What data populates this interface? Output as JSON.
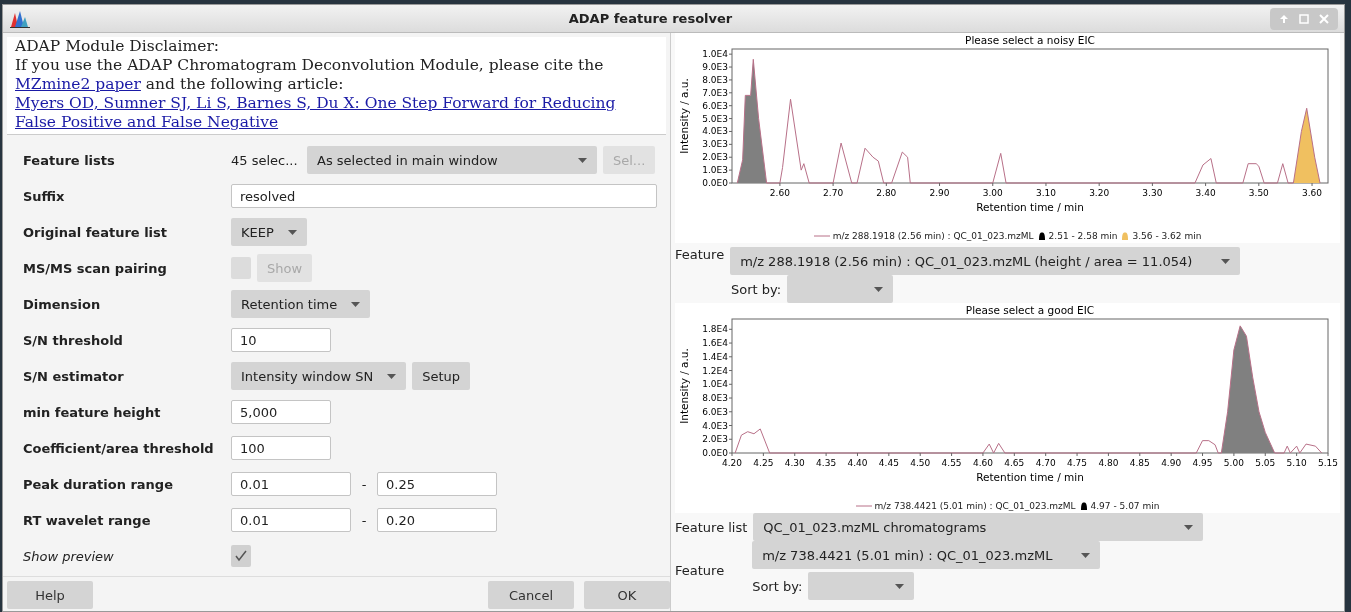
{
  "window": {
    "title": "ADAP feature resolver"
  },
  "disclaimer": {
    "heading": "ADAP Module Disclaimer:",
    "text_before": "If you use the ADAP Chromatogram Deconvolution Module, please cite the",
    "link_paper": "MZmine2 paper",
    "text_after": "and the following article:",
    "link_article": "Myers OD, Sumner SJ, Li S, Barnes S, Du X: One Step Forward for Reducing False Positive and False Negative"
  },
  "parameters": [
    {
      "label": "Feature lists",
      "kind": "selector",
      "count": "45 selec...",
      "value": "As selected in main window",
      "button": "Sel...",
      "disabled": true
    },
    {
      "label": "Suffix",
      "kind": "text",
      "value": "resolved"
    },
    {
      "label": "Original feature list",
      "kind": "combo",
      "value": "KEEP"
    },
    {
      "label": "MS/MS scan pairing",
      "kind": "checkbutton",
      "checked": false,
      "button": "Show",
      "disabled": true
    },
    {
      "label": "Dimension",
      "kind": "combo",
      "value": "Retention time"
    },
    {
      "label": "S/N threshold",
      "kind": "number",
      "value": "10"
    },
    {
      "label": "S/N estimator",
      "kind": "combo",
      "value": "Intensity window SN",
      "button": "Setup"
    },
    {
      "label": "min feature height",
      "kind": "number",
      "value": "5,000"
    },
    {
      "label": "Coefficient/area threshold",
      "kind": "number",
      "value": "100"
    },
    {
      "label": "Peak duration range",
      "kind": "range",
      "from": "0.01",
      "separator": "-",
      "to": "0.25"
    },
    {
      "label": "RT wavelet range",
      "kind": "range",
      "from": "0.01",
      "separator": "-",
      "to": "0.20"
    },
    {
      "label": "Show preview",
      "kind": "checkbox",
      "checked": true
    }
  ],
  "buttons": {
    "help": "Help",
    "cancel": "Cancel",
    "ok": "OK"
  },
  "noisy_preview": {
    "chart_data": {
      "type": "line",
      "title": "Please select a noisy EIC",
      "xlabel": "Retention time / min",
      "ylabel": "Intensity / a.u.",
      "xlim": [
        2.51,
        3.63
      ],
      "ylim": [
        0,
        10400
      ],
      "xticks": [
        {
          "value": 2.6,
          "label": "2.60"
        },
        {
          "value": 2.7,
          "label": "2.70"
        },
        {
          "value": 2.8,
          "label": "2.80"
        },
        {
          "value": 2.9,
          "label": "2.90"
        },
        {
          "value": 3.0,
          "label": "3.00"
        },
        {
          "value": 3.1,
          "label": "3.10"
        },
        {
          "value": 3.2,
          "label": "3.20"
        },
        {
          "value": 3.3,
          "label": "3.30"
        },
        {
          "value": 3.4,
          "label": "3.40"
        },
        {
          "value": 3.5,
          "label": "3.50"
        },
        {
          "value": 3.6,
          "label": "3.60"
        }
      ],
      "yticks": [
        {
          "value": 0,
          "label": "0.0E0"
        },
        {
          "value": 1000,
          "label": "1.0E3"
        },
        {
          "value": 2000,
          "label": "2.0E3"
        },
        {
          "value": 3000,
          "label": "3.0E3"
        },
        {
          "value": 4000,
          "label": "4.0E3"
        },
        {
          "value": 5000,
          "label": "5.0E3"
        },
        {
          "value": 6000,
          "label": "6.0E3"
        },
        {
          "value": 7000,
          "label": "7.0E3"
        },
        {
          "value": 8000,
          "label": "8.0E3"
        },
        {
          "value": 9000,
          "label": "9.0E3"
        },
        {
          "value": 10000,
          "label": "1.0E4"
        }
      ],
      "x": [
        2.52,
        2.53,
        2.535,
        2.545,
        2.55,
        2.56,
        2.575,
        2.6,
        2.605,
        2.62,
        2.64,
        2.645,
        2.655,
        2.7,
        2.715,
        2.735,
        2.745,
        2.76,
        2.775,
        2.785,
        2.795,
        2.81,
        2.83,
        2.84,
        2.845,
        3.0,
        3.015,
        3.025,
        3.38,
        3.395,
        3.41,
        3.42,
        3.47,
        3.48,
        3.495,
        3.5,
        3.51,
        3.535,
        3.545,
        3.555,
        3.565,
        3.58,
        3.59,
        3.605,
        3.615
      ],
      "series": [
        {
          "name": "m/z 288.1918 (2.56 min) : QC_01_023.mzML",
          "type": "line",
          "color": "#b87088",
          "values": [
            0,
            1800,
            6800,
            6800,
            9600,
            5000,
            0,
            0,
            1200,
            6500,
            1000,
            1500,
            0,
            0,
            3100,
            0,
            0,
            2700,
            2000,
            1700,
            0,
            0,
            2400,
            2000,
            0,
            0,
            2300,
            0,
            0,
            1400,
            1900,
            0,
            0,
            1500,
            1500,
            1300,
            0,
            0,
            1500,
            0,
            0,
            4000,
            5800,
            2000,
            0
          ]
        },
        {
          "name": "2.51 - 2.58 min",
          "type": "area",
          "color": "#808080",
          "values": [
            0,
            1800,
            6800,
            6800,
            9600,
            5000,
            0,
            null,
            null,
            null,
            null,
            null,
            null,
            null,
            null,
            null,
            null,
            null,
            null,
            null,
            null,
            null,
            null,
            null,
            null,
            null,
            null,
            null,
            null,
            null,
            null,
            null,
            null,
            null,
            null,
            null,
            null,
            null,
            null,
            null,
            null,
            null,
            null,
            null,
            null
          ]
        },
        {
          "name": "3.56 - 3.62 min",
          "type": "area",
          "color": "#f0c060",
          "values": [
            null,
            null,
            null,
            null,
            null,
            null,
            null,
            null,
            null,
            null,
            null,
            null,
            null,
            null,
            null,
            null,
            null,
            null,
            null,
            null,
            null,
            null,
            null,
            null,
            null,
            null,
            null,
            null,
            null,
            null,
            null,
            null,
            null,
            null,
            null,
            null,
            null,
            null,
            null,
            null,
            0,
            4000,
            5800,
            2000,
            0
          ]
        }
      ]
    },
    "feature_label": "Feature",
    "feature_value": "m/z 288.1918 (2.56 min) : QC_01_023.mzML (height / area = 11.054)",
    "sort_label": "Sort by:"
  },
  "good_preview": {
    "chart_data": {
      "type": "line",
      "title": "Please select a good EIC",
      "xlabel": "Retention time / min",
      "ylabel": "Intensity / a.u.",
      "xlim": [
        4.2,
        5.15
      ],
      "ylim": [
        0,
        19500
      ],
      "xticks": [
        {
          "value": 4.2,
          "label": "4.20"
        },
        {
          "value": 4.25,
          "label": "4.25"
        },
        {
          "value": 4.3,
          "label": "4.30"
        },
        {
          "value": 4.35,
          "label": "4.35"
        },
        {
          "value": 4.4,
          "label": "4.40"
        },
        {
          "value": 4.45,
          "label": "4.45"
        },
        {
          "value": 4.5,
          "label": "4.50"
        },
        {
          "value": 4.55,
          "label": "4.55"
        },
        {
          "value": 4.6,
          "label": "4.60"
        },
        {
          "value": 4.65,
          "label": "4.65"
        },
        {
          "value": 4.7,
          "label": "4.70"
        },
        {
          "value": 4.75,
          "label": "4.75"
        },
        {
          "value": 4.8,
          "label": "4.80"
        },
        {
          "value": 4.85,
          "label": "4.85"
        },
        {
          "value": 4.9,
          "label": "4.90"
        },
        {
          "value": 4.95,
          "label": "4.95"
        },
        {
          "value": 5.0,
          "label": "5.00"
        },
        {
          "value": 5.05,
          "label": "5.05"
        },
        {
          "value": 5.1,
          "label": "5.10"
        },
        {
          "value": 5.15,
          "label": "5.15"
        }
      ],
      "yticks": [
        {
          "value": 0,
          "label": "0.0E0"
        },
        {
          "value": 2000,
          "label": "2.0E3"
        },
        {
          "value": 4000,
          "label": "4.0E3"
        },
        {
          "value": 6000,
          "label": "6.0E3"
        },
        {
          "value": 8000,
          "label": "8.0E3"
        },
        {
          "value": 10000,
          "label": "1.0E4"
        },
        {
          "value": 12000,
          "label": "1.2E4"
        },
        {
          "value": 14000,
          "label": "1.4E4"
        },
        {
          "value": 16000,
          "label": "1.6E4"
        },
        {
          "value": 18000,
          "label": "1.8E4"
        }
      ],
      "x": [
        4.205,
        4.215,
        4.225,
        4.235,
        4.245,
        4.26,
        4.6,
        4.61,
        4.617,
        4.625,
        4.635,
        4.94,
        4.95,
        4.96,
        4.97,
        4.975,
        4.98,
        4.99,
        5.0,
        5.01,
        5.02,
        5.03,
        5.04,
        5.05,
        5.065,
        5.08,
        5.085,
        5.09,
        5.1,
        5.105,
        5.115,
        5.13,
        5.14
      ],
      "series": [
        {
          "name": "m/z 738.4421 (5.01 min) : QC_01_023.mzML",
          "type": "line",
          "color": "#b87088",
          "values": [
            0,
            2600,
            3100,
            2800,
            3500,
            0,
            0,
            1300,
            0,
            1400,
            0,
            0,
            1800,
            1800,
            1200,
            0,
            0,
            6000,
            15000,
            18500,
            17000,
            11000,
            6000,
            3000,
            0,
            0,
            1000,
            0,
            1000,
            0,
            1300,
            1000,
            0
          ]
        },
        {
          "name": "4.97 - 5.07 min",
          "type": "area",
          "color": "#808080",
          "values": [
            null,
            null,
            null,
            null,
            null,
            null,
            null,
            null,
            null,
            null,
            null,
            null,
            null,
            null,
            null,
            0,
            0,
            6000,
            15000,
            18500,
            17000,
            11000,
            6000,
            3000,
            0,
            null,
            null,
            null,
            null,
            null,
            null,
            null,
            null
          ]
        }
      ]
    },
    "feature_list_label": "Feature list",
    "feature_list_value": "QC_01_023.mzML chromatograms",
    "feature_label": "Feature",
    "feature_value": "m/z 738.4421 (5.01 min) : QC_01_023.mzML",
    "sort_label": "Sort by:"
  }
}
